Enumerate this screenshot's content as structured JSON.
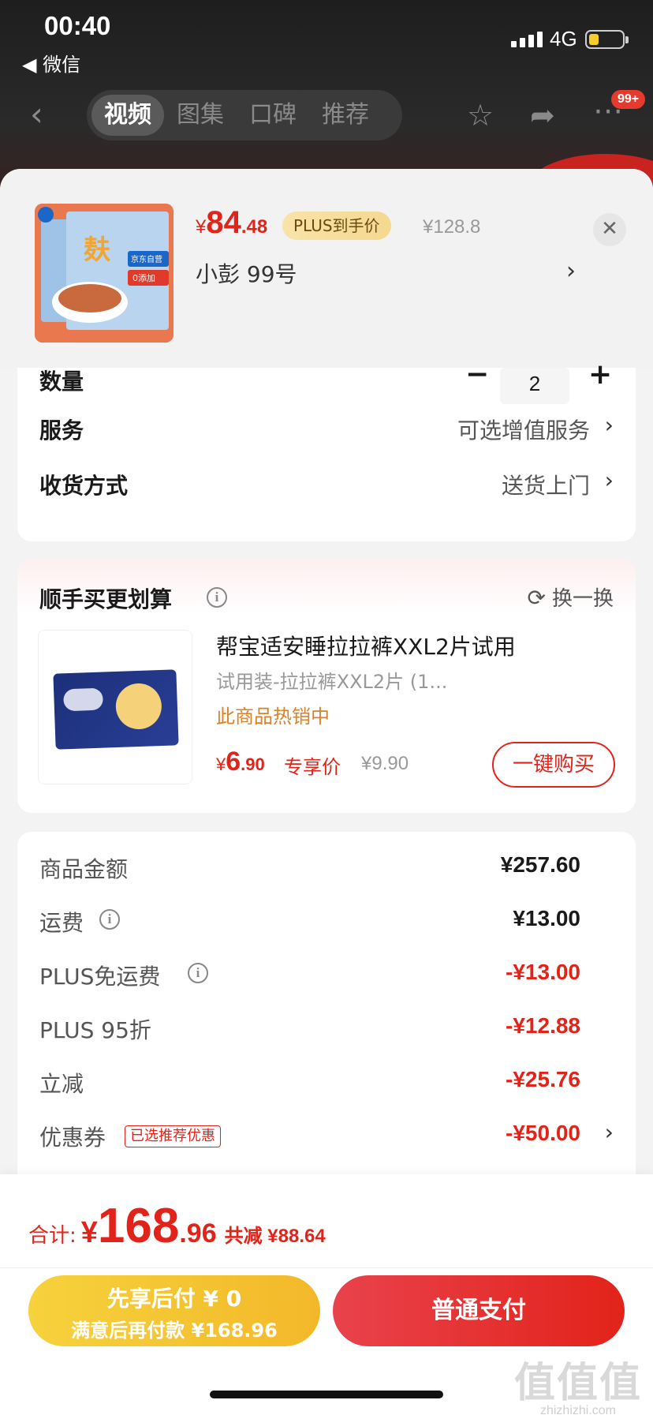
{
  "status_bar": {
    "time": "00:40",
    "back_app": "◀ 微信",
    "network": "4G"
  },
  "nav": {
    "tabs": [
      "视频",
      "图集",
      "口碑",
      "推荐"
    ],
    "active_tab": 0,
    "badge": "99+"
  },
  "product": {
    "price_currency": "¥",
    "price_int": "84",
    "price_dec": ".48",
    "plus_tag": "PLUS到手价",
    "original_price": "¥128.8",
    "variant": "小彭  99号",
    "thumb_labels": [
      "京东自营",
      "0添加"
    ]
  },
  "options": {
    "quantity_label": "数量",
    "quantity_value": "2",
    "service_label": "服务",
    "service_value": "可选增值服务",
    "delivery_label": "收货方式",
    "delivery_value": "送货上门"
  },
  "bundle": {
    "title": "顺手买更划算",
    "swap_label": "换一换",
    "item_name": "帮宝适安睡拉拉裤XXL2片试用",
    "item_spec": "试用装-拉拉裤XXL2片 (1...",
    "item_hot": "此商品热销中",
    "price_currency": "¥",
    "price_int": "6",
    "price_dec": ".90",
    "price_tag": "专享价",
    "original_price": "¥9.90",
    "buy_label": "一键购买"
  },
  "summary": {
    "rows": [
      {
        "label": "商品金额",
        "value": "¥257.60"
      },
      {
        "label": "运费",
        "value": "¥13.00"
      },
      {
        "label": "PLUS免运费",
        "value": "-¥13.00"
      },
      {
        "label": "PLUS 95折",
        "value": "-¥12.88"
      },
      {
        "label": "立减",
        "value": "-¥25.76"
      },
      {
        "label": "优惠券",
        "value": "-¥50.00"
      }
    ],
    "coupon_tag": "已选推荐优惠"
  },
  "checkout": {
    "total_label": "合计:",
    "total_currency": "¥",
    "total_int": "168",
    "total_dec": ".96",
    "saved": "共减 ¥88.64",
    "pay_later_line1": "先享后付 ¥ 0",
    "pay_later_line2": "满意后再付款 ¥168.96",
    "pay_normal": "普通支付"
  },
  "watermark": {
    "big": "值值值",
    "small": "zhizhizhi.com"
  },
  "colors": {
    "accent_red": "#e2231a",
    "plus_gold": "#f5d891",
    "pay_later_yellow": "#f3b829"
  }
}
